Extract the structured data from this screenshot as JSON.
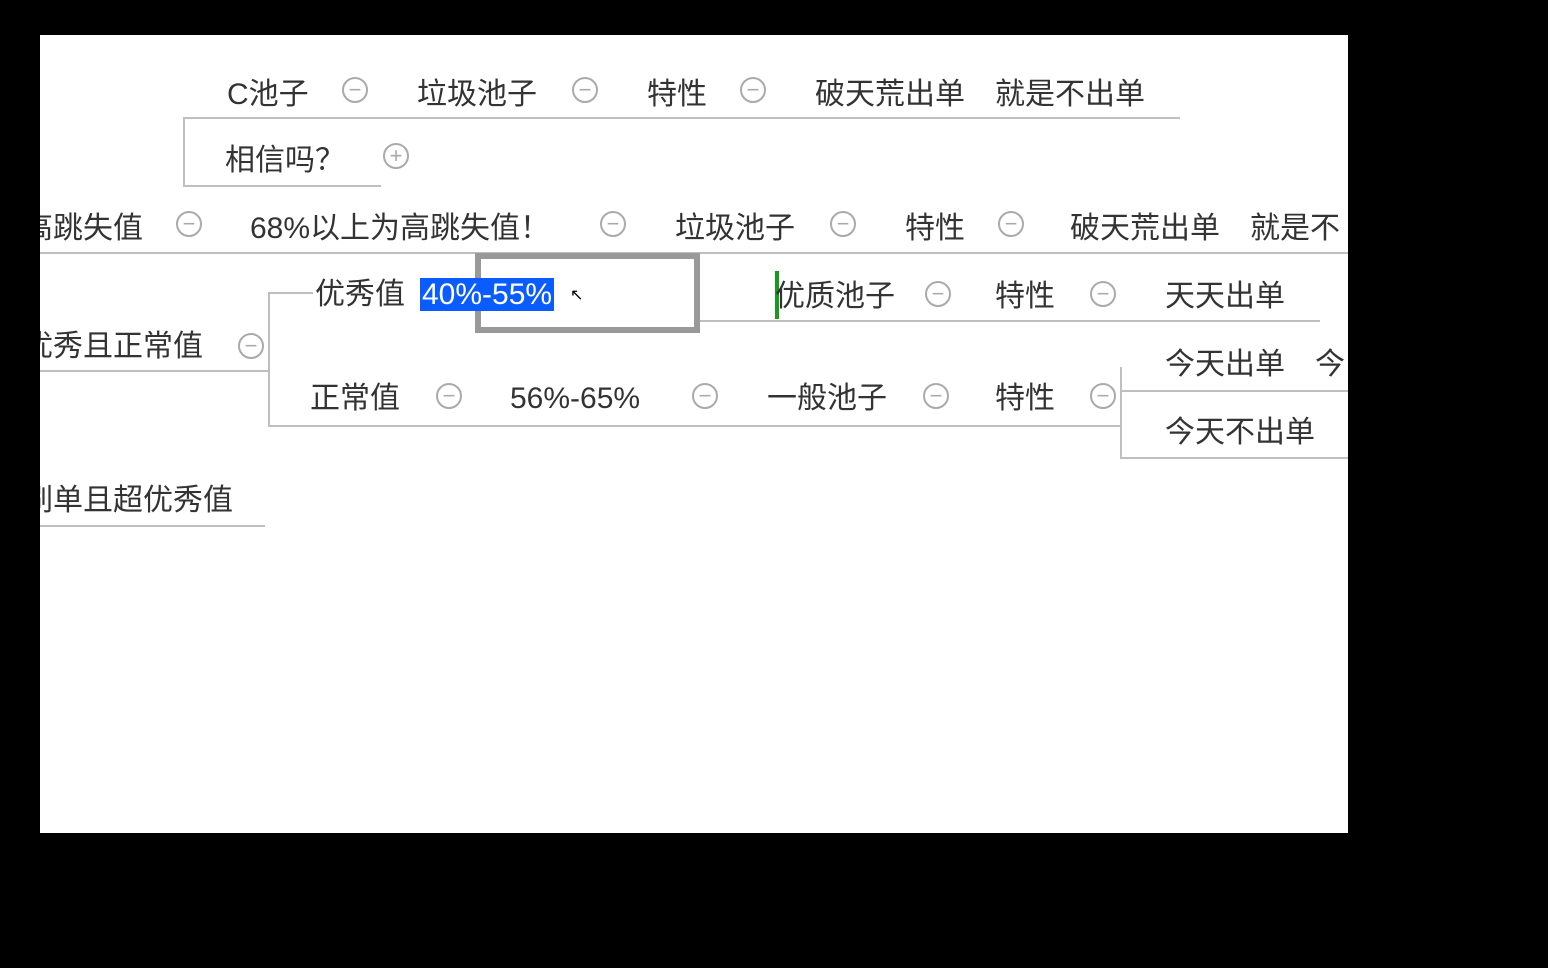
{
  "nodes": {
    "c_pool": "C池子",
    "trash_pool_1": "垃圾池子",
    "trait_1": "特性",
    "rare_order": "破天荒出单",
    "no_order": "就是不出单",
    "believe": "相信吗？",
    "high_bounce_partial": "高跳失值",
    "high_bounce_68": "68%以上为高跳失值！",
    "trash_pool_2": "垃圾池子",
    "trait_2": "特性",
    "rare_order_2": "破天荒出单",
    "no_order_2_partial": "就是不",
    "excellent_normal_partial": "优秀且正常值",
    "excellent": "优秀值",
    "range_40_55": "40%-55%",
    "quality_pool": "优质池子",
    "trait_3": "特性",
    "daily_order": "天天出单",
    "normal": "正常值",
    "range_56_65": "56%-65%",
    "normal_pool": "一般池子",
    "trait_4": "特性",
    "today_order": "今天出单",
    "today_partial": "今",
    "today_no_order": "今天不出单",
    "super_excellent_partial": "刷单且超优秀值"
  },
  "icons": {
    "minus": "−",
    "plus": "+"
  }
}
